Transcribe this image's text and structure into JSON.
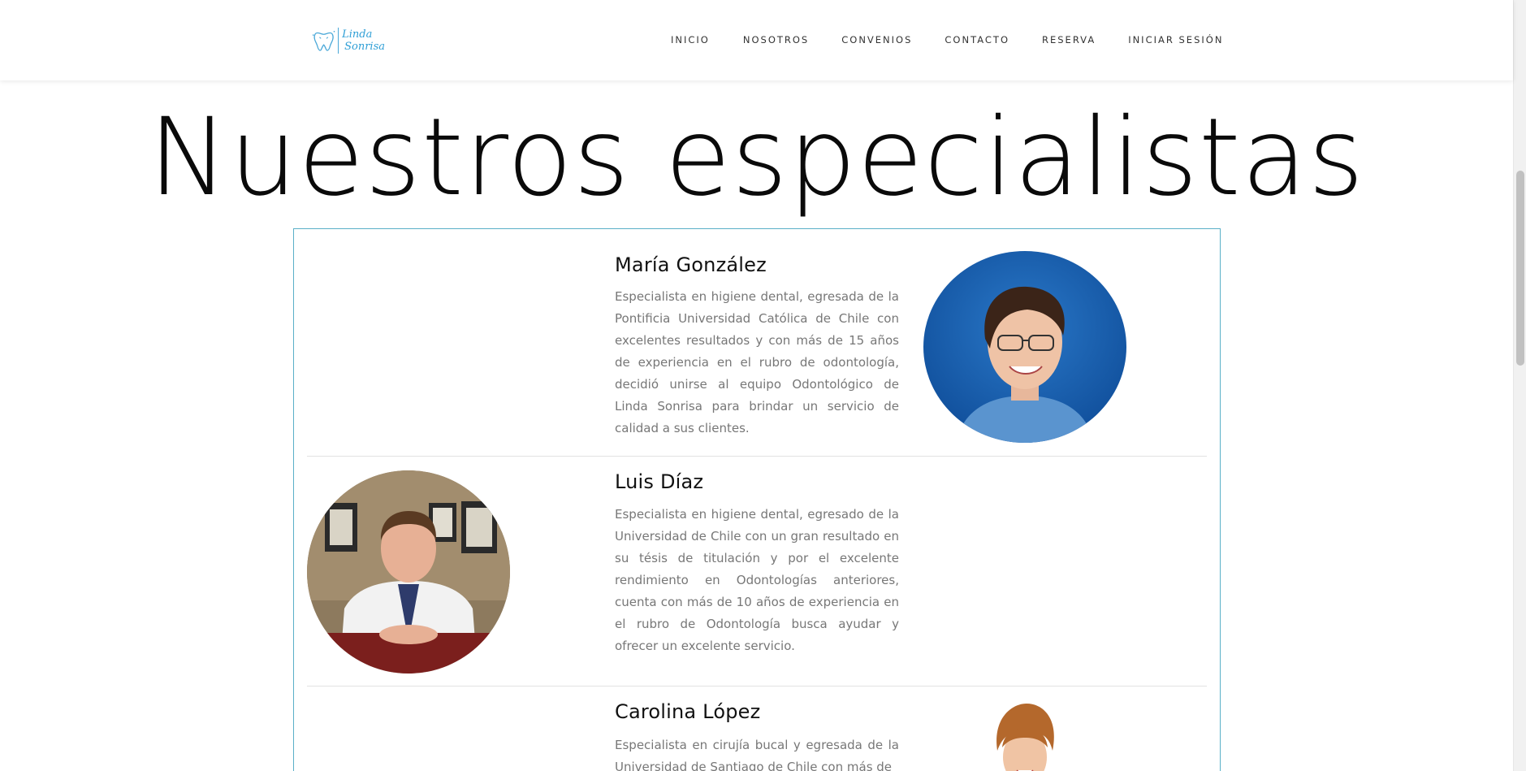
{
  "header": {
    "logo": {
      "line1": "Linda",
      "line2": "Sonrisa"
    },
    "nav": [
      {
        "label": "INICIO"
      },
      {
        "label": "NOSOTROS"
      },
      {
        "label": "CONVENIOS"
      },
      {
        "label": "CONTACTO"
      },
      {
        "label": "RESERVA"
      },
      {
        "label": "INICIAR SESIÓN"
      }
    ]
  },
  "main": {
    "title": "Nuestros especialistas",
    "specialists": [
      {
        "name": "María González",
        "description": "Especialista en higiene dental, egresada de la Pontificia Universidad Católica de Chile con excelentes resultados y con más de 15 años de experiencia en el rubro de odontología, decidió unirse al equipo Odontológico de Linda Sonrisa para brindar un servicio de calidad a sus clientes."
      },
      {
        "name": "Luis Díaz",
        "description": "Especialista en higiene dental, egresado de la Universidad de Chile con un gran resultado en su tésis de titulación y por el excelente rendimiento en Odontologías anteriores, cuenta con más de 10 años de experiencia en el rubro de Odontología busca ayudar y ofrecer un excelente servicio."
      },
      {
        "name": "Carolina López",
        "description": "Especialista en cirujía bucal y egresada de la Universidad de Santiago de Chile con más de"
      }
    ]
  },
  "colors": {
    "accent": "#2f9fd6",
    "box_border": "#5ab0c8",
    "body_text": "#777777"
  }
}
